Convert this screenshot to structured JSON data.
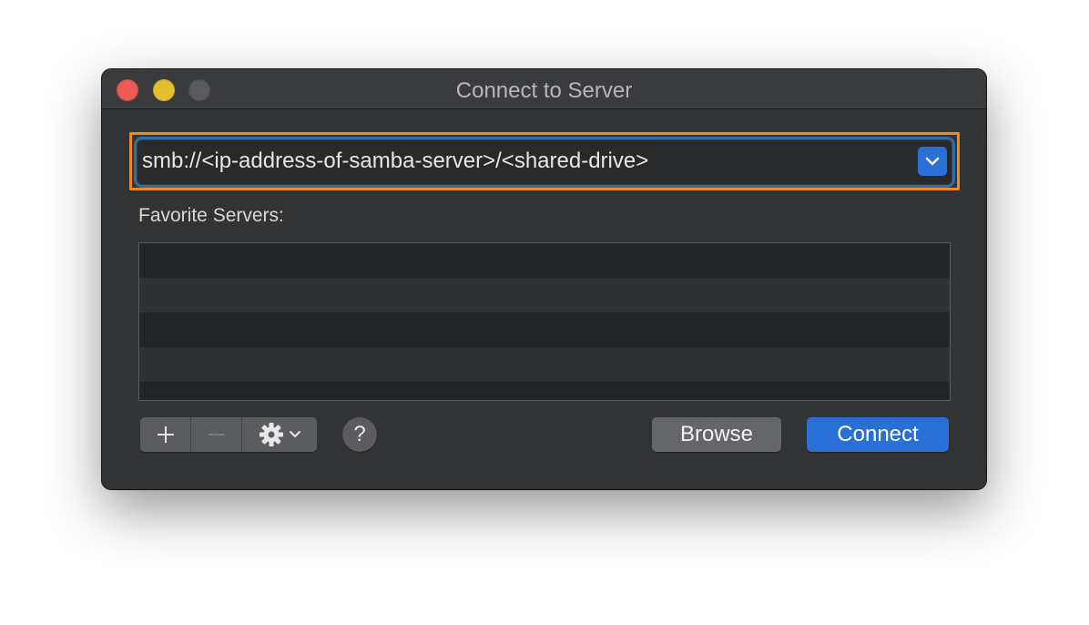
{
  "window": {
    "title": "Connect to Server"
  },
  "server_address": {
    "value": "smb://<ip-address-of-samba-server>/<shared-drive>"
  },
  "favorites": {
    "label": "Favorite Servers:",
    "rows": [
      "",
      "",
      "",
      "",
      ""
    ]
  },
  "toolbar": {
    "add_icon": "plus-icon",
    "remove_icon": "minus-icon",
    "action_icon": "gear-icon",
    "help_label": "?"
  },
  "buttons": {
    "browse_label": "Browse",
    "connect_label": "Connect"
  },
  "colors": {
    "highlight": "#ef8a1c",
    "accent": "#2a6fd6"
  }
}
